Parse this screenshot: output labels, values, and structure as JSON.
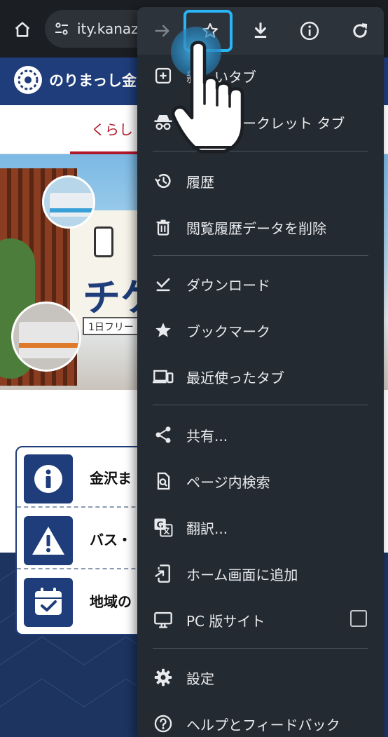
{
  "browser": {
    "url_text": "ity.kanaz",
    "home_icon": "home-icon",
    "site_settings_icon": "tune-icon"
  },
  "site": {
    "title": "のりまっし金",
    "nav_tab": "くらし",
    "banner": {
      "headline": "チケ",
      "sub": "1日フリー"
    },
    "info_items": [
      {
        "icon": "info-icon",
        "label": "金沢ま"
      },
      {
        "icon": "warning-icon",
        "label": "バス・"
      },
      {
        "icon": "calendar-check-icon",
        "label": "地域の"
      }
    ]
  },
  "menu": {
    "toolbar": [
      {
        "name": "forward-icon"
      },
      {
        "name": "bookmark-star-icon"
      },
      {
        "name": "download-icon"
      },
      {
        "name": "info-icon"
      },
      {
        "name": "reload-icon"
      }
    ],
    "items": [
      {
        "id": "new-tab",
        "label": "新しいタブ",
        "icon": "add-box-icon"
      },
      {
        "id": "incognito-tab",
        "label": "新しいシークレット タブ",
        "icon": "incognito-icon"
      },
      {
        "id": "history",
        "label": "履歴",
        "icon": "history-icon"
      },
      {
        "id": "clear-data",
        "label": "閲覧履歴データを削除",
        "icon": "trash-icon"
      },
      {
        "id": "downloads",
        "label": "ダウンロード",
        "icon": "download-done-icon"
      },
      {
        "id": "bookmarks",
        "label": "ブックマーク",
        "icon": "star-icon"
      },
      {
        "id": "recent-tabs",
        "label": "最近使ったタブ",
        "icon": "devices-icon"
      },
      {
        "id": "share",
        "label": "共有...",
        "icon": "share-icon"
      },
      {
        "id": "find-in-page",
        "label": "ページ内検索",
        "icon": "find-in-page-icon"
      },
      {
        "id": "translate",
        "label": "翻訳...",
        "icon": "translate-icon"
      },
      {
        "id": "add-to-home",
        "label": "ホーム画面に追加",
        "icon": "add-to-home-icon"
      },
      {
        "id": "desktop-site",
        "label": "PC 版サイト",
        "icon": "monitor-icon",
        "checked": false
      },
      {
        "id": "settings",
        "label": "設定",
        "icon": "gear-icon"
      },
      {
        "id": "help",
        "label": "ヘルプとフィードバック",
        "icon": "help-icon"
      }
    ]
  },
  "overlay": {
    "hand_icon": "pointing-hand-icon",
    "highlight_target": "bookmark-star-icon",
    "accent": "#29b6f6"
  },
  "colors": {
    "menu_bg": "#242a31",
    "site_blue": "#1f3d7a",
    "nav_red": "#b0182b"
  }
}
